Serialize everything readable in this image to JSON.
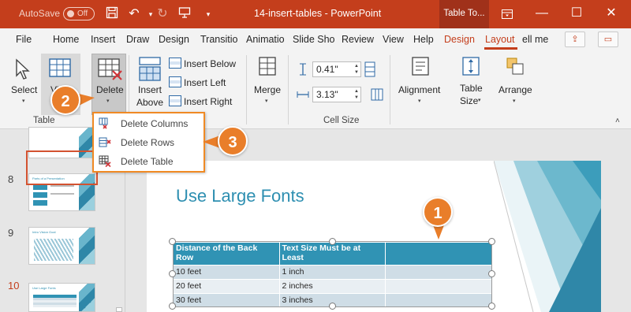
{
  "titlebar": {
    "autosave_label": "AutoSave",
    "toggle_state": "Off",
    "doc_title": "14-insert-tables  -  PowerPoint",
    "context_title": "Table To...",
    "accent": "#c43e1c"
  },
  "tabs": [
    {
      "label": "File"
    },
    {
      "label": "Home"
    },
    {
      "label": "Insert"
    },
    {
      "label": "Draw"
    },
    {
      "label": "Design"
    },
    {
      "label": "Transitio"
    },
    {
      "label": "Animatio"
    },
    {
      "label": "Slide Sho"
    },
    {
      "label": "Review"
    },
    {
      "label": "View"
    },
    {
      "label": "Help"
    },
    {
      "label": "Design"
    },
    {
      "label": "Layout"
    },
    {
      "label": "ell me"
    }
  ],
  "ribbon": {
    "select_label": "Select",
    "view_gridlines_label": "Vi G",
    "delete_label": "Delete",
    "insert_above_line1": "Insert",
    "insert_above_line2": "Above",
    "insert_below": "Insert Below",
    "insert_left": "Insert Left",
    "insert_right": "Insert Right",
    "merge_label": "Merge",
    "height_value": "0.41\"",
    "width_value": "3.13\"",
    "alignment_label": "Alignment",
    "table_size_line1": "Table",
    "table_size_line2": "Size",
    "arrange_label": "Arrange",
    "group_table": "Table",
    "group_cell_size": "Cell Size"
  },
  "delete_menu": {
    "items": [
      {
        "label": "Delete Columns",
        "icon": "delete-columns-icon"
      },
      {
        "label": "Delete Rows",
        "icon": "delete-rows-icon"
      },
      {
        "label": "Delete Table",
        "icon": "delete-table-icon"
      }
    ]
  },
  "callouts": {
    "one": "1",
    "two": "2",
    "three": "3",
    "color": "#e97e2a"
  },
  "slides_panel": {
    "numbers": [
      "8",
      "9",
      "10"
    ],
    "thumb_titles": [
      "Parts of a Presentation",
      "Intro Vision Goal",
      "Use Large Fonts"
    ],
    "current": "10"
  },
  "slide": {
    "title": "Use Large Fonts",
    "table": {
      "headers": [
        "Distance of the Back Row",
        "Text Size Must be at Least",
        ""
      ],
      "rows": [
        [
          "10 feet",
          "1 inch",
          ""
        ],
        [
          "20 feet",
          "2 inches",
          ""
        ],
        [
          "30 feet",
          "3 inches",
          ""
        ]
      ]
    }
  }
}
